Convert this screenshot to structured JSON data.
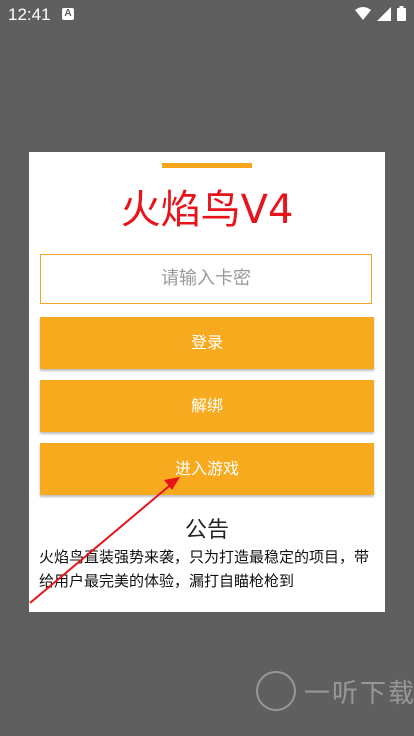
{
  "status_bar": {
    "time": "12:41",
    "notif_icon_label": "A",
    "icons": [
      "wifi-icon",
      "signal-icon",
      "battery-icon"
    ]
  },
  "dialog": {
    "title": "火焰鸟V4",
    "input_placeholder": "请输入卡密",
    "buttons": {
      "login": "登录",
      "unbind": "解绑",
      "enter_game": "进入游戏"
    },
    "notice_title": "公告",
    "notice_text": "火焰鸟直装强势来袭，只为打造最稳定的项目，带给用户最完美的体验，漏打自瞄枪枪到"
  },
  "watermark": {
    "text": "一听下载"
  },
  "colors": {
    "accent": "#f8aa1e",
    "title": "#e8141b",
    "annotation_arrow": "#e8141b"
  }
}
